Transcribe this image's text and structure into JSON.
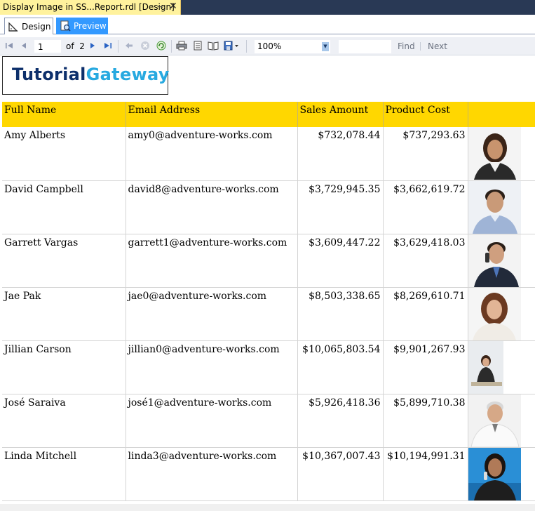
{
  "document_tab": {
    "title": "Display Image in SS...Report.rdl [Design]",
    "pin_glyph": "⊸",
    "close_glyph": "✕"
  },
  "view_tabs": [
    {
      "label": "Design",
      "icon": "design-icon"
    },
    {
      "label": "Preview",
      "icon": "preview-icon",
      "selected": true
    }
  ],
  "toolbar": {
    "page_current": "1",
    "page_of_label": "of",
    "page_total": "2",
    "zoom": "100%",
    "find_label": "Find",
    "next_label": "Next"
  },
  "logo": {
    "part1": "Tutorial",
    "part2": "Gateway",
    "colors": {
      "part1": "#0d2f6b",
      "part2": "#27a9e0"
    }
  },
  "table": {
    "header_color": "#ffd700",
    "columns": [
      "Full Name",
      "Email Address",
      "Sales Amount",
      "Product Cost",
      ""
    ],
    "rows": [
      {
        "name": "Amy Alberts",
        "email": "amy0@adventure-works.com",
        "sales": "$732,078.44",
        "cost": "$737,293.63"
      },
      {
        "name": "David Campbell",
        "email": "david8@adventure-works.com",
        "sales": "$3,729,945.35",
        "cost": "$3,662,619.72"
      },
      {
        "name": "Garrett Vargas",
        "email": "garrett1@adventure-works.com",
        "sales": "$3,609,447.22",
        "cost": "$3,629,418.03"
      },
      {
        "name": "Jae Pak",
        "email": "jae0@adventure-works.com",
        "sales": "$8,503,338.65",
        "cost": "$8,269,610.71"
      },
      {
        "name": "Jillian Carson",
        "email": "jillian0@adventure-works.com",
        "sales": "$10,065,803.54",
        "cost": "$9,901,267.93"
      },
      {
        "name": "José Saraiva",
        "email": "josé1@adventure-works.com",
        "sales": "$5,926,418.36",
        "cost": "$5,899,710.38"
      },
      {
        "name": "Linda Mitchell",
        "email": "linda3@adventure-works.com",
        "sales": "$10,367,007.43",
        "cost": "$10,194,991.31"
      }
    ]
  }
}
